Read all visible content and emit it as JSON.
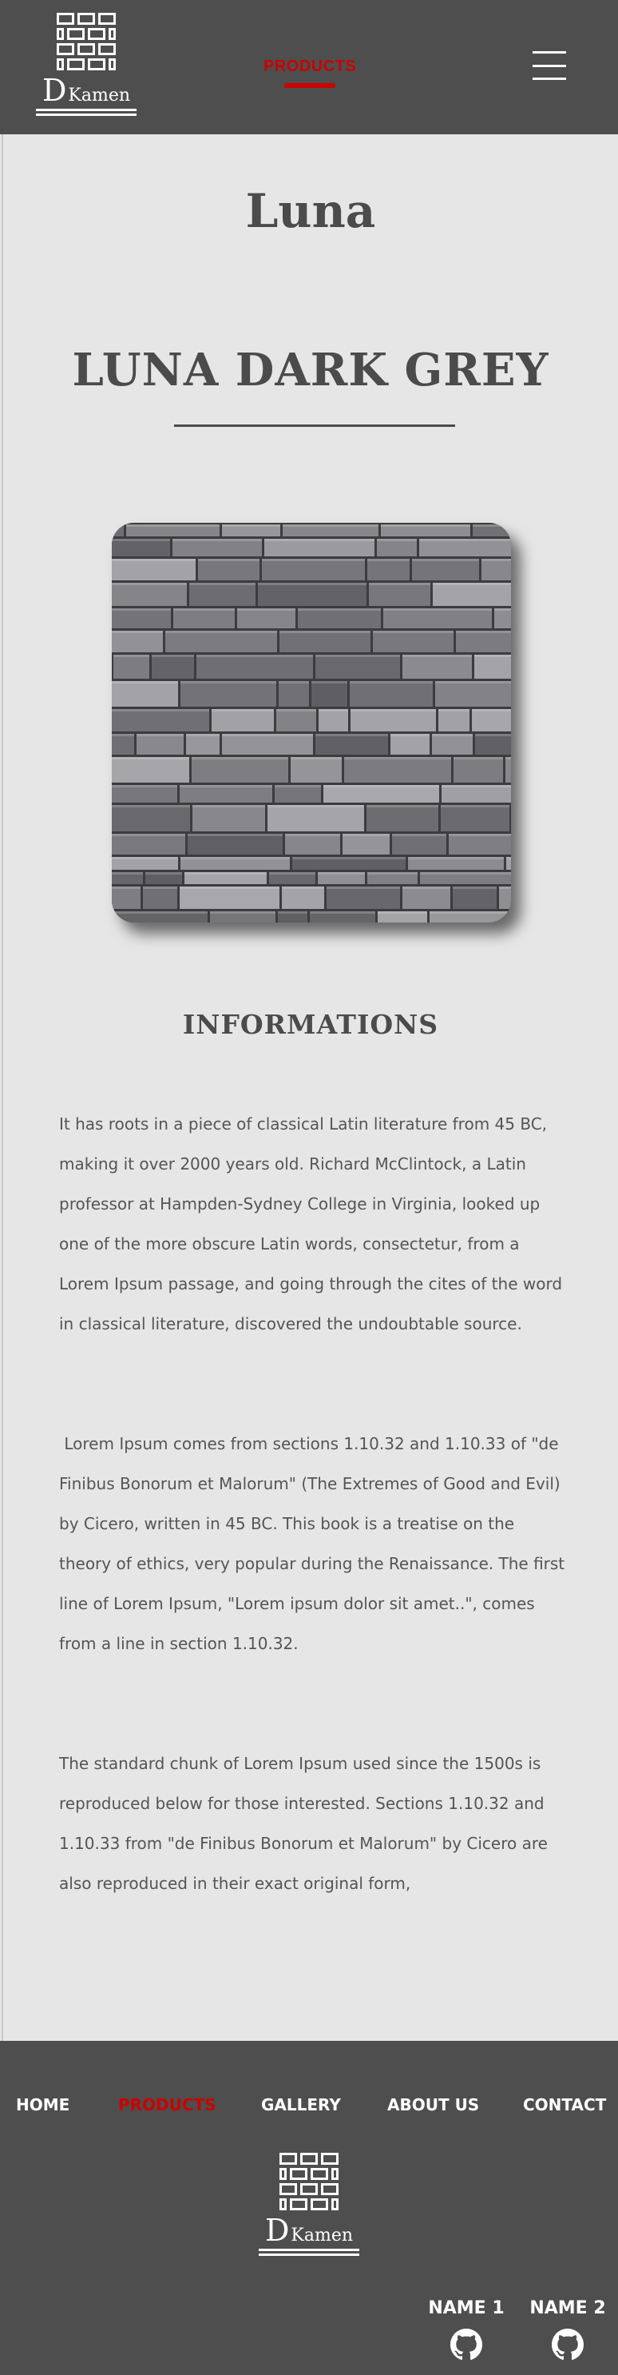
{
  "header": {
    "logo": {
      "letter": "D",
      "word": "Kamen"
    },
    "nav_active": "PRODUCTS",
    "menu_icon": "hamburger-icon"
  },
  "main": {
    "collection": "Luna",
    "product_name": "LUNA DARK GREY",
    "image_subject": "stone-wall-icon",
    "info_title": "INFORMATIONS",
    "paragraphs": [
      "It has roots in a piece of classical Latin literature from 45 BC, making it over 2000 years old. Richard McClintock, a Latin professor at Hampden-Sydney College in Virginia, looked up one of the more obscure Latin words, consectetur, from a Lorem Ipsum passage, and going through the cites of the word in classical literature, discovered the undoubtable source.",
      " Lorem Ipsum comes from sections 1.10.32 and 1.10.33 of \"de Finibus Bonorum et Malorum\" (The Extremes of Good and Evil) by Cicero, written in 45 BC. This book is a treatise on the theory of ethics, very popular during the Renaissance. The first line of Lorem Ipsum, \"Lorem ipsum dolor sit amet..\", comes from a line in section 1.10.32.",
      "The standard chunk of Lorem Ipsum used since the 1500s is reproduced below for those interested. Sections 1.10.32 and 1.10.33 from \"de Finibus Bonorum et Malorum\" by Cicero are also reproduced in their exact original form,"
    ]
  },
  "footer": {
    "nav": [
      {
        "label": "HOME",
        "active": false
      },
      {
        "label": "PRODUCTS",
        "active": true
      },
      {
        "label": "GALLERY",
        "active": false
      },
      {
        "label": "ABOUT US",
        "active": false
      },
      {
        "label": "CONTACT",
        "active": false
      }
    ],
    "logo": {
      "letter": "D",
      "word": "Kamen"
    },
    "credits": [
      {
        "name": "NAME 1",
        "icon": "github-icon"
      },
      {
        "name": "NAME 2",
        "icon": "github-icon"
      }
    ]
  },
  "colors": {
    "header_bg": "#4e4e4e",
    "page_bg": "#e6e6e6",
    "accent": "#cc0000",
    "text": "#4b4b4b"
  }
}
